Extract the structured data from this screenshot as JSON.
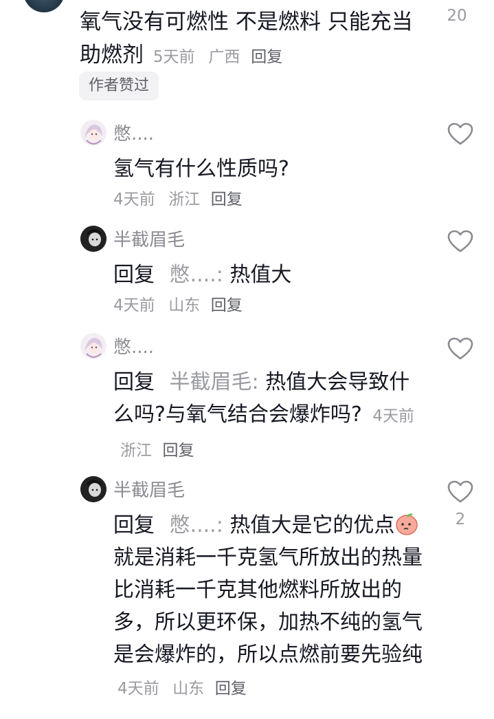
{
  "top_comment": {
    "text": "氧气没有可燃性 不是燃料 只能充当助燃剂",
    "time": "5天前",
    "location": "广西",
    "reply_label": "回复",
    "likes": "20",
    "badge": "作者赞过"
  },
  "replies": [
    {
      "username": "憋....",
      "prefix": "",
      "target": "",
      "text": "氢气有什么性质吗?",
      "time": "4天前",
      "location": "浙江",
      "reply_label": "回复",
      "likes": ""
    },
    {
      "username": "半截眉毛",
      "prefix": "回复",
      "target": "憋....",
      "text": "热值大",
      "time": "4天前",
      "location": "山东",
      "reply_label": "回复",
      "likes": ""
    },
    {
      "username": "憋....",
      "prefix": "回复",
      "target": "半截眉毛",
      "text": "热值大会导致什么吗?与氧气结合会爆炸吗?",
      "time": "4天前",
      "location": "浙江",
      "reply_label": "回复",
      "likes": ""
    },
    {
      "username": "半截眉毛",
      "prefix": "回复",
      "target": "憋....",
      "text_a": "热值大是它的优点",
      "text_b": "就是消耗一千克氢气所放出的热量比消耗一千克其他燃料所放出的多，所以更环保，加热不纯的氢气是会爆炸的，所以点燃前要先验纯",
      "time": "4天前",
      "location": "山东",
      "reply_label": "回复",
      "likes": "2"
    }
  ],
  "icons": {
    "heart": "heart-outline-icon",
    "emoji": "peach-emoji-icon"
  }
}
